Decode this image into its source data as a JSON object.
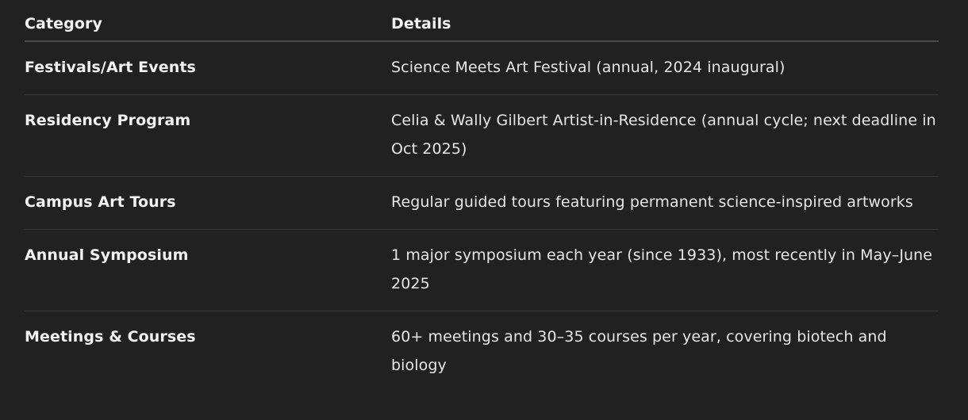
{
  "table": {
    "headers": [
      "Category",
      "Details"
    ],
    "rows": [
      {
        "category": "Festivals/Art Events",
        "details": "Science Meets Art Festival (annual, 2024 inaugural)"
      },
      {
        "category": "Residency Program",
        "details": "Celia & Wally Gilbert Artist-in-Residence (annual cycle; next deadline in Oct 2025)"
      },
      {
        "category": "Campus Art Tours",
        "details": "Regular guided tours featuring permanent science-inspired artworks"
      },
      {
        "category": "Annual Symposium",
        "details": "1 major symposium each year (since 1933), most recently in May–June 2025"
      },
      {
        "category": "Meetings & Courses",
        "details": "60+ meetings and 30–35 courses per year, covering biotech and biology"
      }
    ]
  }
}
